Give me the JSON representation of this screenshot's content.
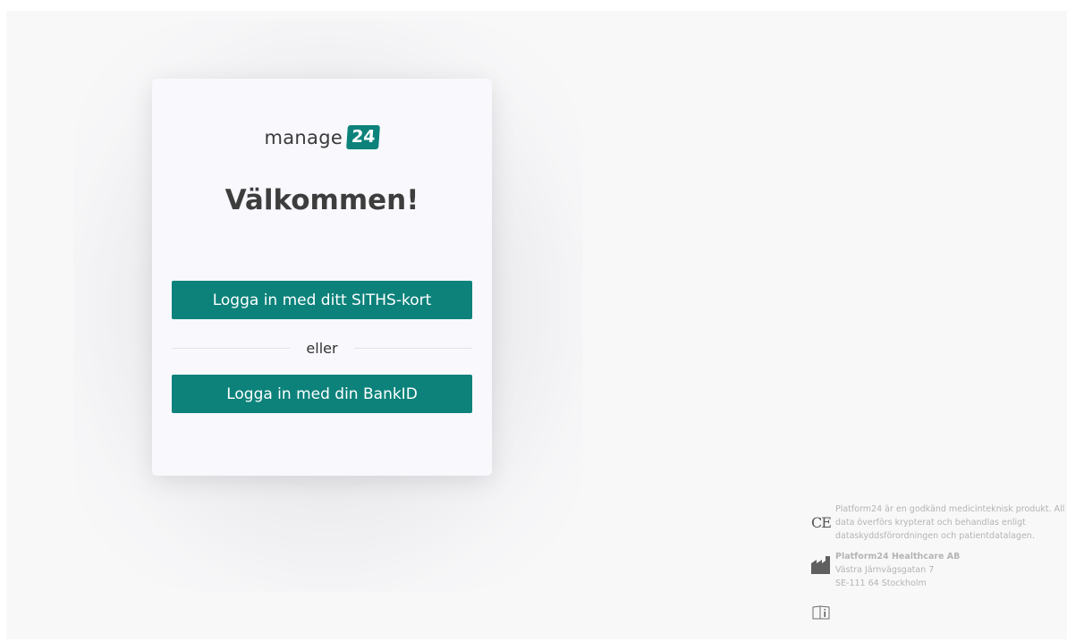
{
  "logo": {
    "text": "manage",
    "badge": "24"
  },
  "title": "Välkommen!",
  "buttons": {
    "siths_label": "Logga in med ditt SITHS-kort",
    "bankid_label": "Logga in med din BankID"
  },
  "divider_text": "eller",
  "footer": {
    "ce_text": "Platform24 är en godkänd medicinteknisk produkt. All data överförs krypterat och behandlas enligt dataskyddsförordningen och patientdatalagen.",
    "company": "Platform24 Healthcare AB",
    "street": "Västra Järnvägsgatan 7",
    "city": "SE-111 64 Stockholm",
    "ce_mark": "CE"
  },
  "colors": {
    "accent": "#0c827b",
    "title": "#3d3d3d",
    "footer_text": "#b4b4b4"
  },
  "icons": [
    "ce-mark-icon",
    "manufacturer-icon",
    "instructions-icon"
  ]
}
